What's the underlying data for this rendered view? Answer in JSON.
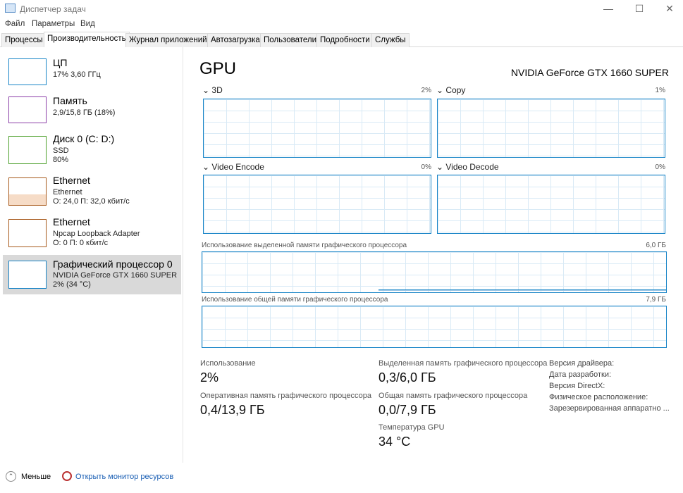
{
  "window": {
    "title": "Диспетчер задач"
  },
  "menu": [
    "Файл",
    "Параметры",
    "Вид"
  ],
  "tabs": [
    "Процессы",
    "Производительность",
    "Журнал приложений",
    "Автозагрузка",
    "Пользователи",
    "Подробности",
    "Службы"
  ],
  "sidebar": [
    {
      "name": "ЦП",
      "sub1": "17% 3,60 ГГц",
      "color": "#1784c7"
    },
    {
      "name": "Память",
      "sub1": "2,9/15,8 ГБ (18%)",
      "color": "#8b3fa8"
    },
    {
      "name": "Диск 0 (C: D:)",
      "sub1": "SSD",
      "sub2": "80%",
      "color": "#4da02c"
    },
    {
      "name": "Ethernet",
      "sub1": "Ethernet",
      "sub2": "О: 24,0 П: 32,0 кбит/с",
      "color": "#a7581a"
    },
    {
      "name": "Ethernet",
      "sub1": "Npcap Loopback Adapter",
      "sub2": "О: 0 П: 0 кбит/с",
      "color": "#a7581a"
    },
    {
      "name": "Графический процессор 0",
      "sub1": "NVIDIA GeForce GTX 1660 SUPER",
      "sub2": "2% (34 °C)",
      "color": "#1784c7"
    }
  ],
  "main": {
    "title": "GPU",
    "device": "NVIDIA GeForce GTX 1660 SUPER",
    "engines": [
      {
        "label": "3D",
        "value": "2%"
      },
      {
        "label": "Copy",
        "value": "1%"
      },
      {
        "label": "Video Encode",
        "value": "0%"
      },
      {
        "label": "Video Decode",
        "value": "0%"
      }
    ],
    "dedicated": {
      "label": "Использование выделенной памяти графического процессора",
      "max": "6,0 ГБ"
    },
    "shared": {
      "label": "Использование общей памяти графического процессора",
      "max": "7,9 ГБ"
    },
    "stats": {
      "usage_label": "Использование",
      "usage": "2%",
      "ram_label": "Оперативная память графического процессора",
      "ram": "0,4/13,9 ГБ",
      "ded_label": "Выделенная память графического процессора",
      "ded": "0,3/6,0 ГБ",
      "sh_label": "Общая память графического процессора",
      "sh": "0,0/7,9 ГБ",
      "temp_label": "Температура GPU",
      "temp": "34 °C"
    },
    "info": [
      "Версия драйвера:",
      "Дата разработки:",
      "Версия DirectX:",
      "Физическое расположение:",
      "Зарезервированная аппаратно ..."
    ]
  },
  "footer": {
    "less": "Меньше",
    "monitor": "Открыть монитор ресурсов"
  }
}
